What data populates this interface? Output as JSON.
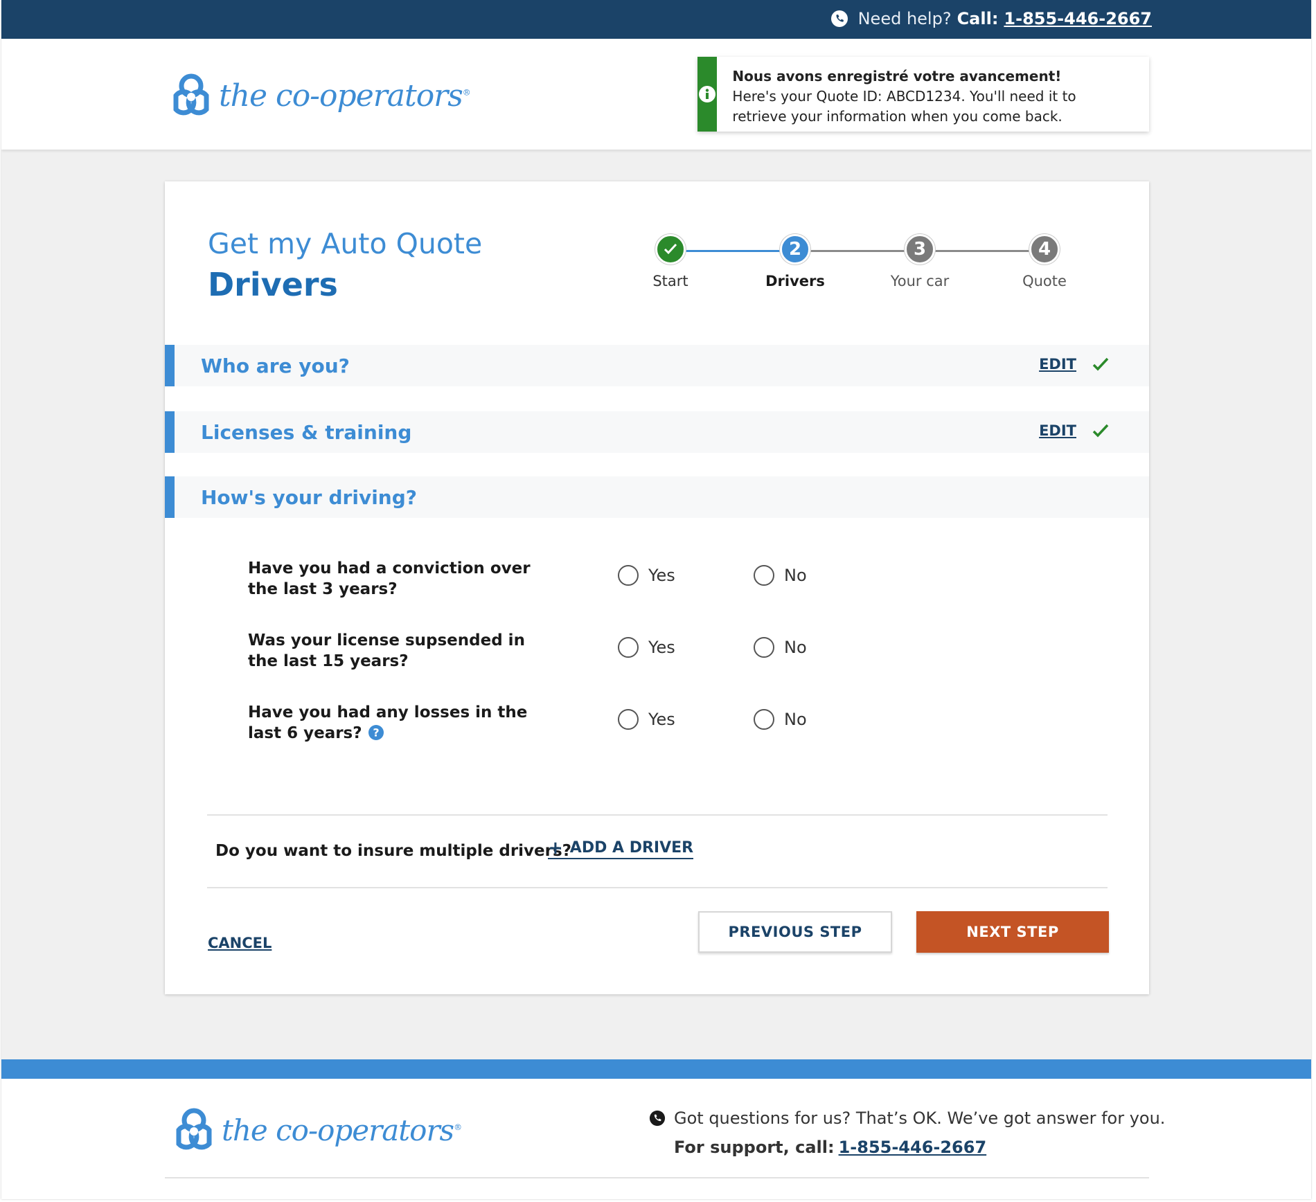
{
  "topbar": {
    "help_label": "Need help?",
    "call_label": "Call:",
    "phone": "1-855-446-2667"
  },
  "brand": {
    "name": "the co-operators",
    "reg": "®"
  },
  "toast": {
    "title": "Nous avons enregistré votre avancement!",
    "message": "Here's your Quote ID: ABCD1234. You'll need it to retrieve your information when you come back."
  },
  "page": {
    "subtitle": "Get my Auto Quote",
    "title": "Drivers"
  },
  "stepper": {
    "steps": [
      {
        "number": "1",
        "label": "Start",
        "state": "done"
      },
      {
        "number": "2",
        "label": "Drivers",
        "state": "active"
      },
      {
        "number": "3",
        "label": "Your car",
        "state": "pending"
      },
      {
        "number": "4",
        "label": "Quote",
        "state": "pending"
      }
    ]
  },
  "sections": [
    {
      "title": "Who are you?",
      "edit_label": "EDIT",
      "complete": true
    },
    {
      "title": "Licenses & training",
      "edit_label": "EDIT",
      "complete": true
    },
    {
      "title": "How's your driving?",
      "edit_label": "",
      "complete": false
    }
  ],
  "questions": [
    {
      "text": "Have you had a conviction over the last 3 years?",
      "yes": "Yes",
      "no": "No"
    },
    {
      "text": "Was your license supsended in the last 15 years?",
      "yes": "Yes",
      "no": "No"
    },
    {
      "text": "Have you had any losses in the last 6 years?",
      "yes": "Yes",
      "no": "No",
      "has_help": true
    }
  ],
  "multi_driver": {
    "question": "Do you want to insure multiple drivers?",
    "add_label": "ADD A DRIVER"
  },
  "actions": {
    "cancel": "CANCEL",
    "previous": "PREVIOUS STEP",
    "next": "NEXT STEP"
  },
  "footer": {
    "questions_text": "Got questions for us? That’s OK. We’ve got answer for you.",
    "support_label": "For support, call:",
    "phone": "1-855-446-2667"
  },
  "colors": {
    "navy": "#1b4368",
    "brand_blue": "#3d8cd4",
    "success_green": "#2b8a2b",
    "cta_orange": "#c45425",
    "step_pending": "#7a7a7a"
  }
}
